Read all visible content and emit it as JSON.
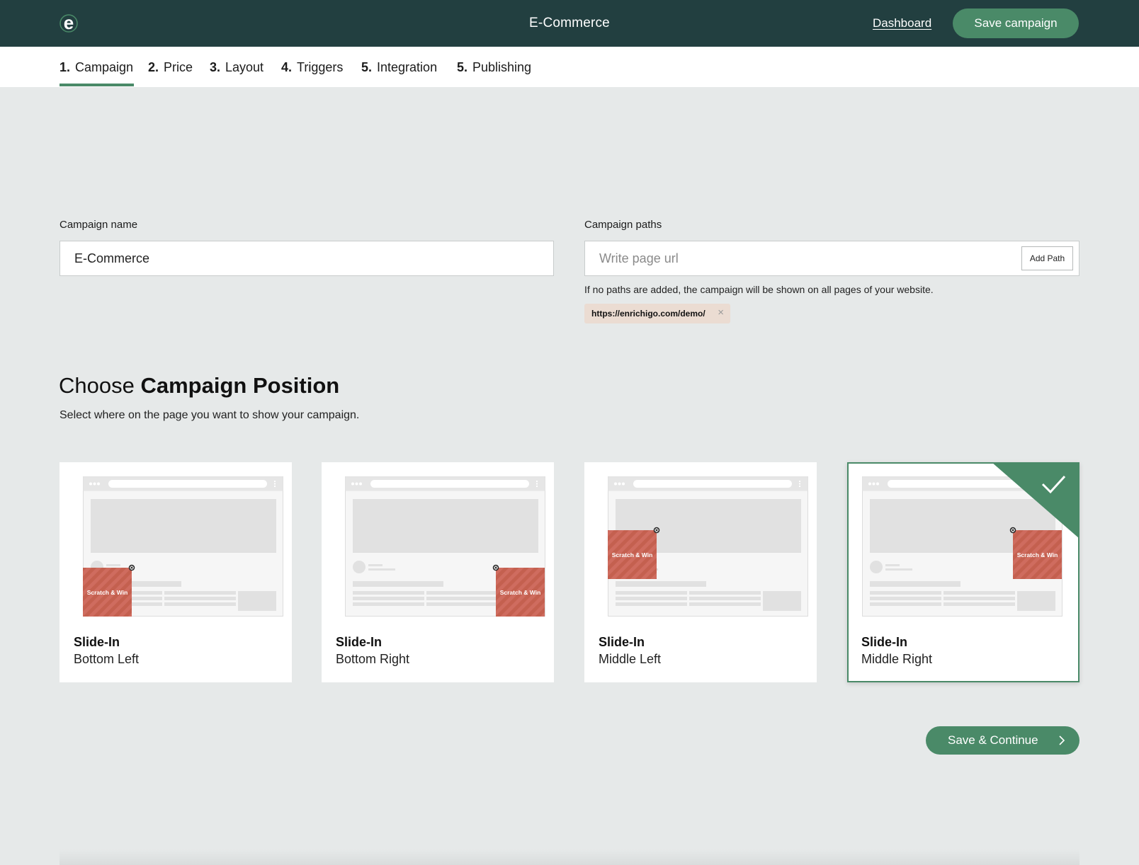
{
  "header": {
    "app_title": "E-Commerce",
    "dashboard_link": "Dashboard",
    "save_button": "Save campaign"
  },
  "tabs": [
    {
      "num": "1.",
      "label": "Campaign",
      "active": true
    },
    {
      "num": "2.",
      "label": "Price"
    },
    {
      "num": "3.",
      "label": "Layout"
    },
    {
      "num": "4.",
      "label": "Triggers"
    },
    {
      "num": "5.",
      "label": "Integration"
    },
    {
      "num": "5.",
      "label": "Publishing"
    }
  ],
  "form": {
    "name_label": "Campaign name",
    "name_value": "E-Commerce",
    "paths_label": "Campaign paths",
    "paths_placeholder": "Write page url",
    "add_path_button": "Add Path",
    "paths_hint": "If no paths are added, the campaign will be shown on all pages of your website.",
    "path_chip": "https://enrichigo.com/demo/",
    "chip_remove": "×"
  },
  "position": {
    "heading_light": "Choose",
    "heading_bold": "Campaign Position",
    "subtitle": "Select where on the page you want to show your campaign.",
    "widget_label": "Scratch & Win",
    "cards": [
      {
        "title": "Slide-In",
        "subtitle": "Bottom Left"
      },
      {
        "title": "Slide-In",
        "subtitle": "Bottom Right"
      },
      {
        "title": "Slide-In",
        "subtitle": "Middle Left"
      },
      {
        "title": "Slide-In",
        "subtitle": "Middle Right",
        "selected": true
      }
    ]
  },
  "footer": {
    "continue_button": "Save & Continue"
  },
  "colors": {
    "header_bg": "#223f40",
    "accent_green": "#4a8a68",
    "widget_red": "#cf6c5f",
    "page_bg": "#e6e9e9"
  },
  "icons": {
    "logo": "brand-e-logo",
    "selected_check": "check-icon",
    "continue": "chevron-right-icon",
    "chip_remove": "close-icon"
  }
}
